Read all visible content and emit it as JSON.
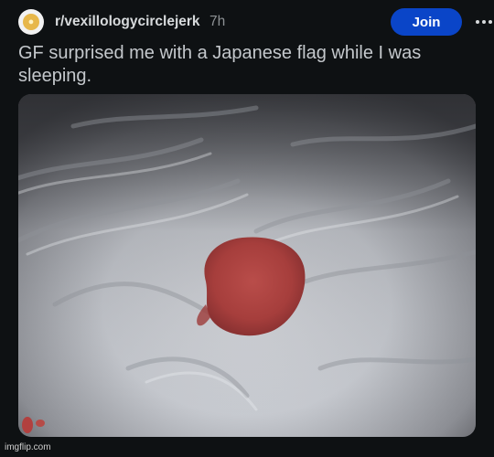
{
  "post": {
    "subreddit": "r/vexillologycirclejerk",
    "age": "7h",
    "join_label": "Join",
    "more_icon": "ellipsis-horizontal-icon",
    "title": "GF surprised me with a Japanese flag while I was sleeping.",
    "image_description_icon": "photo"
  },
  "watermark": "imgflip.com"
}
